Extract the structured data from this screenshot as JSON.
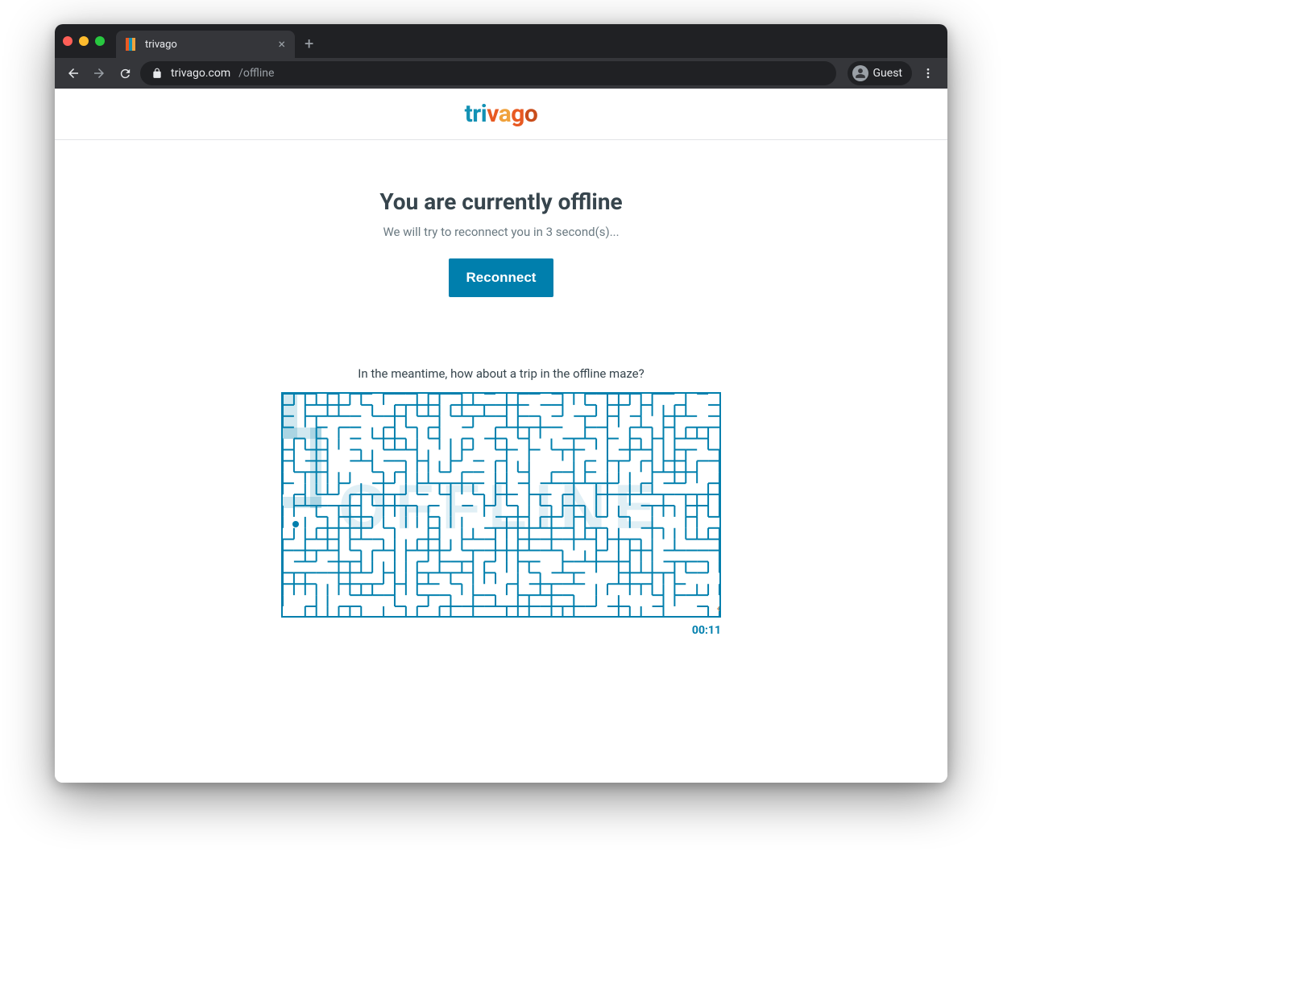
{
  "browser": {
    "tab_title": "trivago",
    "url_host": "trivago.com",
    "url_path": "/offline",
    "profile_label": "Guest"
  },
  "logo": {
    "text": "trivago"
  },
  "offline": {
    "heading": "You are currently offline",
    "subtext": "We will try to reconnect you in 3 second(s)...",
    "button": "Reconnect",
    "meantime": "In the meantime, how about a trip in the offline maze?",
    "maze_word": "OFFLINE",
    "timer": "00:11"
  }
}
